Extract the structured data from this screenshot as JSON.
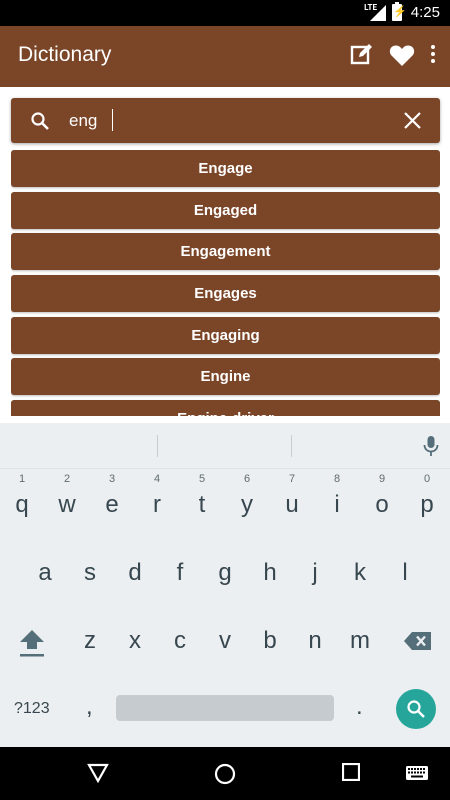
{
  "status_bar": {
    "network": "LTE",
    "time": "4:25"
  },
  "app_bar": {
    "title": "Dictionary",
    "icons": [
      "edit-icon",
      "heart-icon",
      "more-vert-icon"
    ]
  },
  "search": {
    "value": "eng",
    "placeholder": ""
  },
  "results": [
    "Engage",
    "Engaged",
    "Engagement",
    "Engages",
    "Engaging",
    "Engine",
    "Engine-driver"
  ],
  "keyboard": {
    "row1": [
      "q",
      "w",
      "e",
      "r",
      "t",
      "y",
      "u",
      "i",
      "o",
      "p"
    ],
    "row1_hints": [
      "1",
      "2",
      "3",
      "4",
      "5",
      "6",
      "7",
      "8",
      "9",
      "0"
    ],
    "row2": [
      "a",
      "s",
      "d",
      "f",
      "g",
      "h",
      "j",
      "k",
      "l"
    ],
    "row3": [
      "z",
      "x",
      "c",
      "v",
      "b",
      "n",
      "m"
    ],
    "symbols_label": "?123",
    "comma": ",",
    "period": ".",
    "accent_color": "#26a69a"
  },
  "colors": {
    "brand": "#7b4528",
    "keyboard_bg": "#eceff1"
  }
}
